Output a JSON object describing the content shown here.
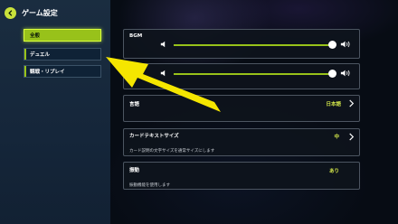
{
  "header": {
    "title": "ゲーム設定",
    "back_icon": "chevron-left-icon"
  },
  "sidebar": {
    "tabs": [
      {
        "label": "全般",
        "active": true
      },
      {
        "label": "デュエル",
        "active": false
      },
      {
        "label": "観戦・リプレイ",
        "active": false
      }
    ]
  },
  "settings": {
    "bgm": {
      "label": "BGM",
      "level": 0.94
    },
    "se": {
      "level": 0.94
    },
    "language": {
      "label": "言語",
      "value": "日本語"
    },
    "card_text_size": {
      "label": "カードテキストサイズ",
      "value": "中",
      "description": "カード説明の文字サイズを通常サイズにします"
    },
    "vibration": {
      "label": "振動",
      "value": "あり",
      "description": "振動機能を使用します"
    }
  },
  "colors": {
    "accent": "#98c21a",
    "accent_bright": "#d9ff3c",
    "value_text": "#d3e64a",
    "annotation_arrow": "#f5e600"
  }
}
